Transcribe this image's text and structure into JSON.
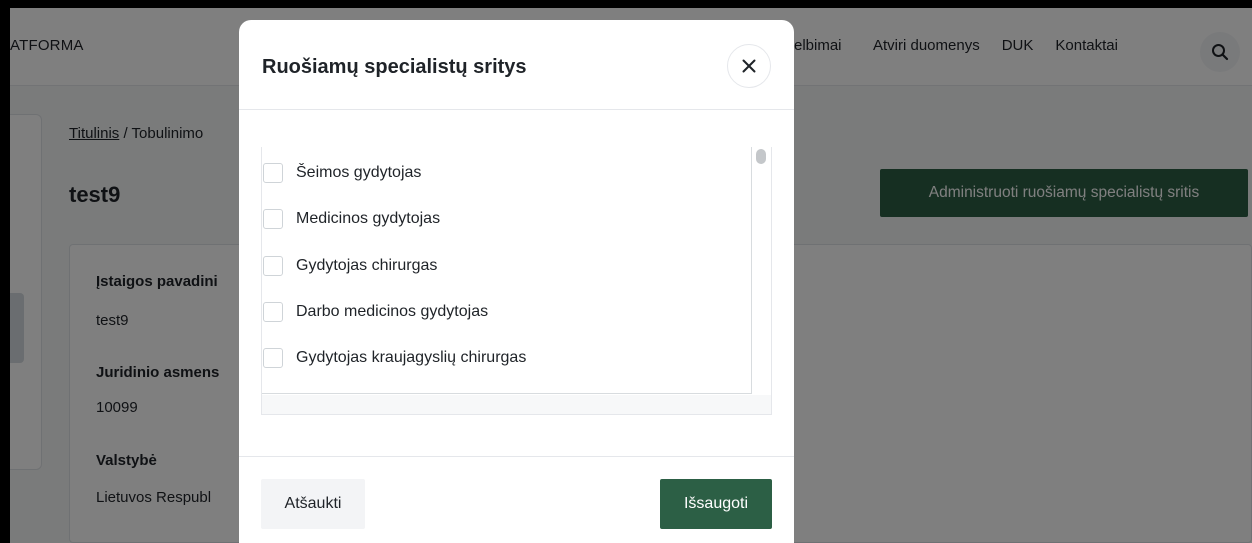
{
  "nav": {
    "brand": "ATFORMA",
    "partial_link": "elbimai",
    "links": [
      "Atviri duomenys",
      "DUK",
      "Kontaktai"
    ],
    "search_icon": "search-icon"
  },
  "breadcrumb": {
    "home": "Titulinis",
    "separator": "/",
    "current": "Tobulinimo"
  },
  "page": {
    "title": "test9",
    "admin_button": "Administruoti ruošiamų specialistų sritis"
  },
  "info": {
    "fields": [
      {
        "label": "Įstaigos pavadini",
        "value": "test9"
      },
      {
        "label": "Juridinio asmens",
        "value": "10099"
      },
      {
        "label": "Valstybė",
        "value": "Lietuvos Respubl"
      }
    ]
  },
  "modal": {
    "title": "Ruošiamų specialistų sritys",
    "close_icon": "close-icon",
    "options": [
      {
        "label": "Šeimos gydytojas",
        "checked": false
      },
      {
        "label": "Medicinos gydytojas",
        "checked": false
      },
      {
        "label": "Gydytojas chirurgas",
        "checked": false
      },
      {
        "label": "Darbo medicinos gydytojas",
        "checked": false
      },
      {
        "label": "Gydytojas kraujagyslių chirurgas",
        "checked": false
      }
    ],
    "cancel_label": "Atšaukti",
    "save_label": "Išsaugoti"
  },
  "colors": {
    "primary_green": "#2c5f45",
    "overlay": "rgba(0,0,0,0.5)"
  }
}
